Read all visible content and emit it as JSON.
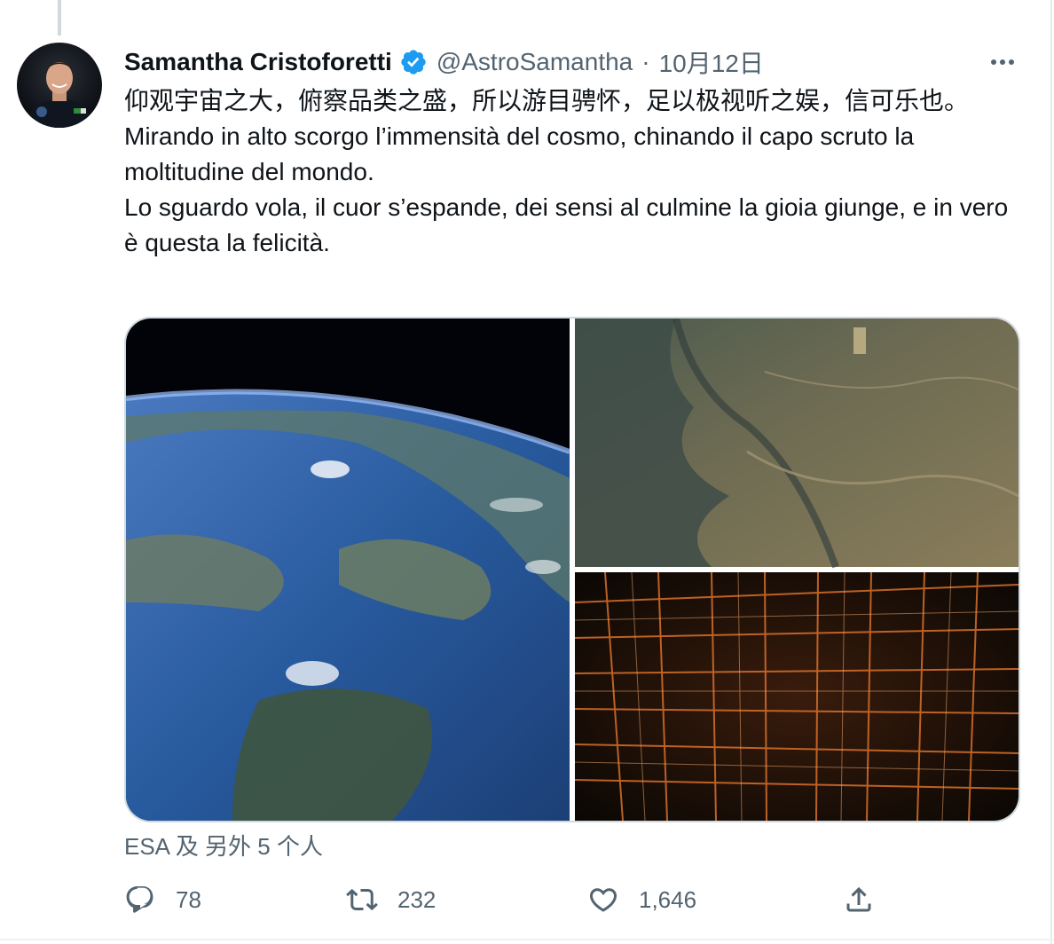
{
  "author": {
    "name": "Samantha Cristoforetti",
    "handle": "@AstroSamantha",
    "date": "10月12日",
    "separator": "·"
  },
  "tweet": {
    "lines": [
      "仰观宇宙之大，俯察品类之盛，所以游目骋怀，足以极视听之娱，信可乐也。",
      "Mirando in alto scorgo l’immensità del cosmo, chinando il capo scruto la moltitudine del mondo.",
      "Lo sguardo vola, il cuor s’espande, dei sensi al culmine la gioia giunge, e in vero è questa la felicità."
    ]
  },
  "tagged_text": "ESA 及 另外 5 个人",
  "actions": {
    "reply_count": "78",
    "retweet_count": "232",
    "like_count": "1,646"
  },
  "icons": {
    "verified": "verified-badge-icon",
    "more": "more-options-icon",
    "reply": "reply-icon",
    "retweet": "retweet-icon",
    "like": "heart-icon",
    "share": "share-icon"
  },
  "colors": {
    "text": "#0f1419",
    "secondary": "#536471",
    "verified": "#1d9bf0",
    "border": "#cfd9de"
  }
}
